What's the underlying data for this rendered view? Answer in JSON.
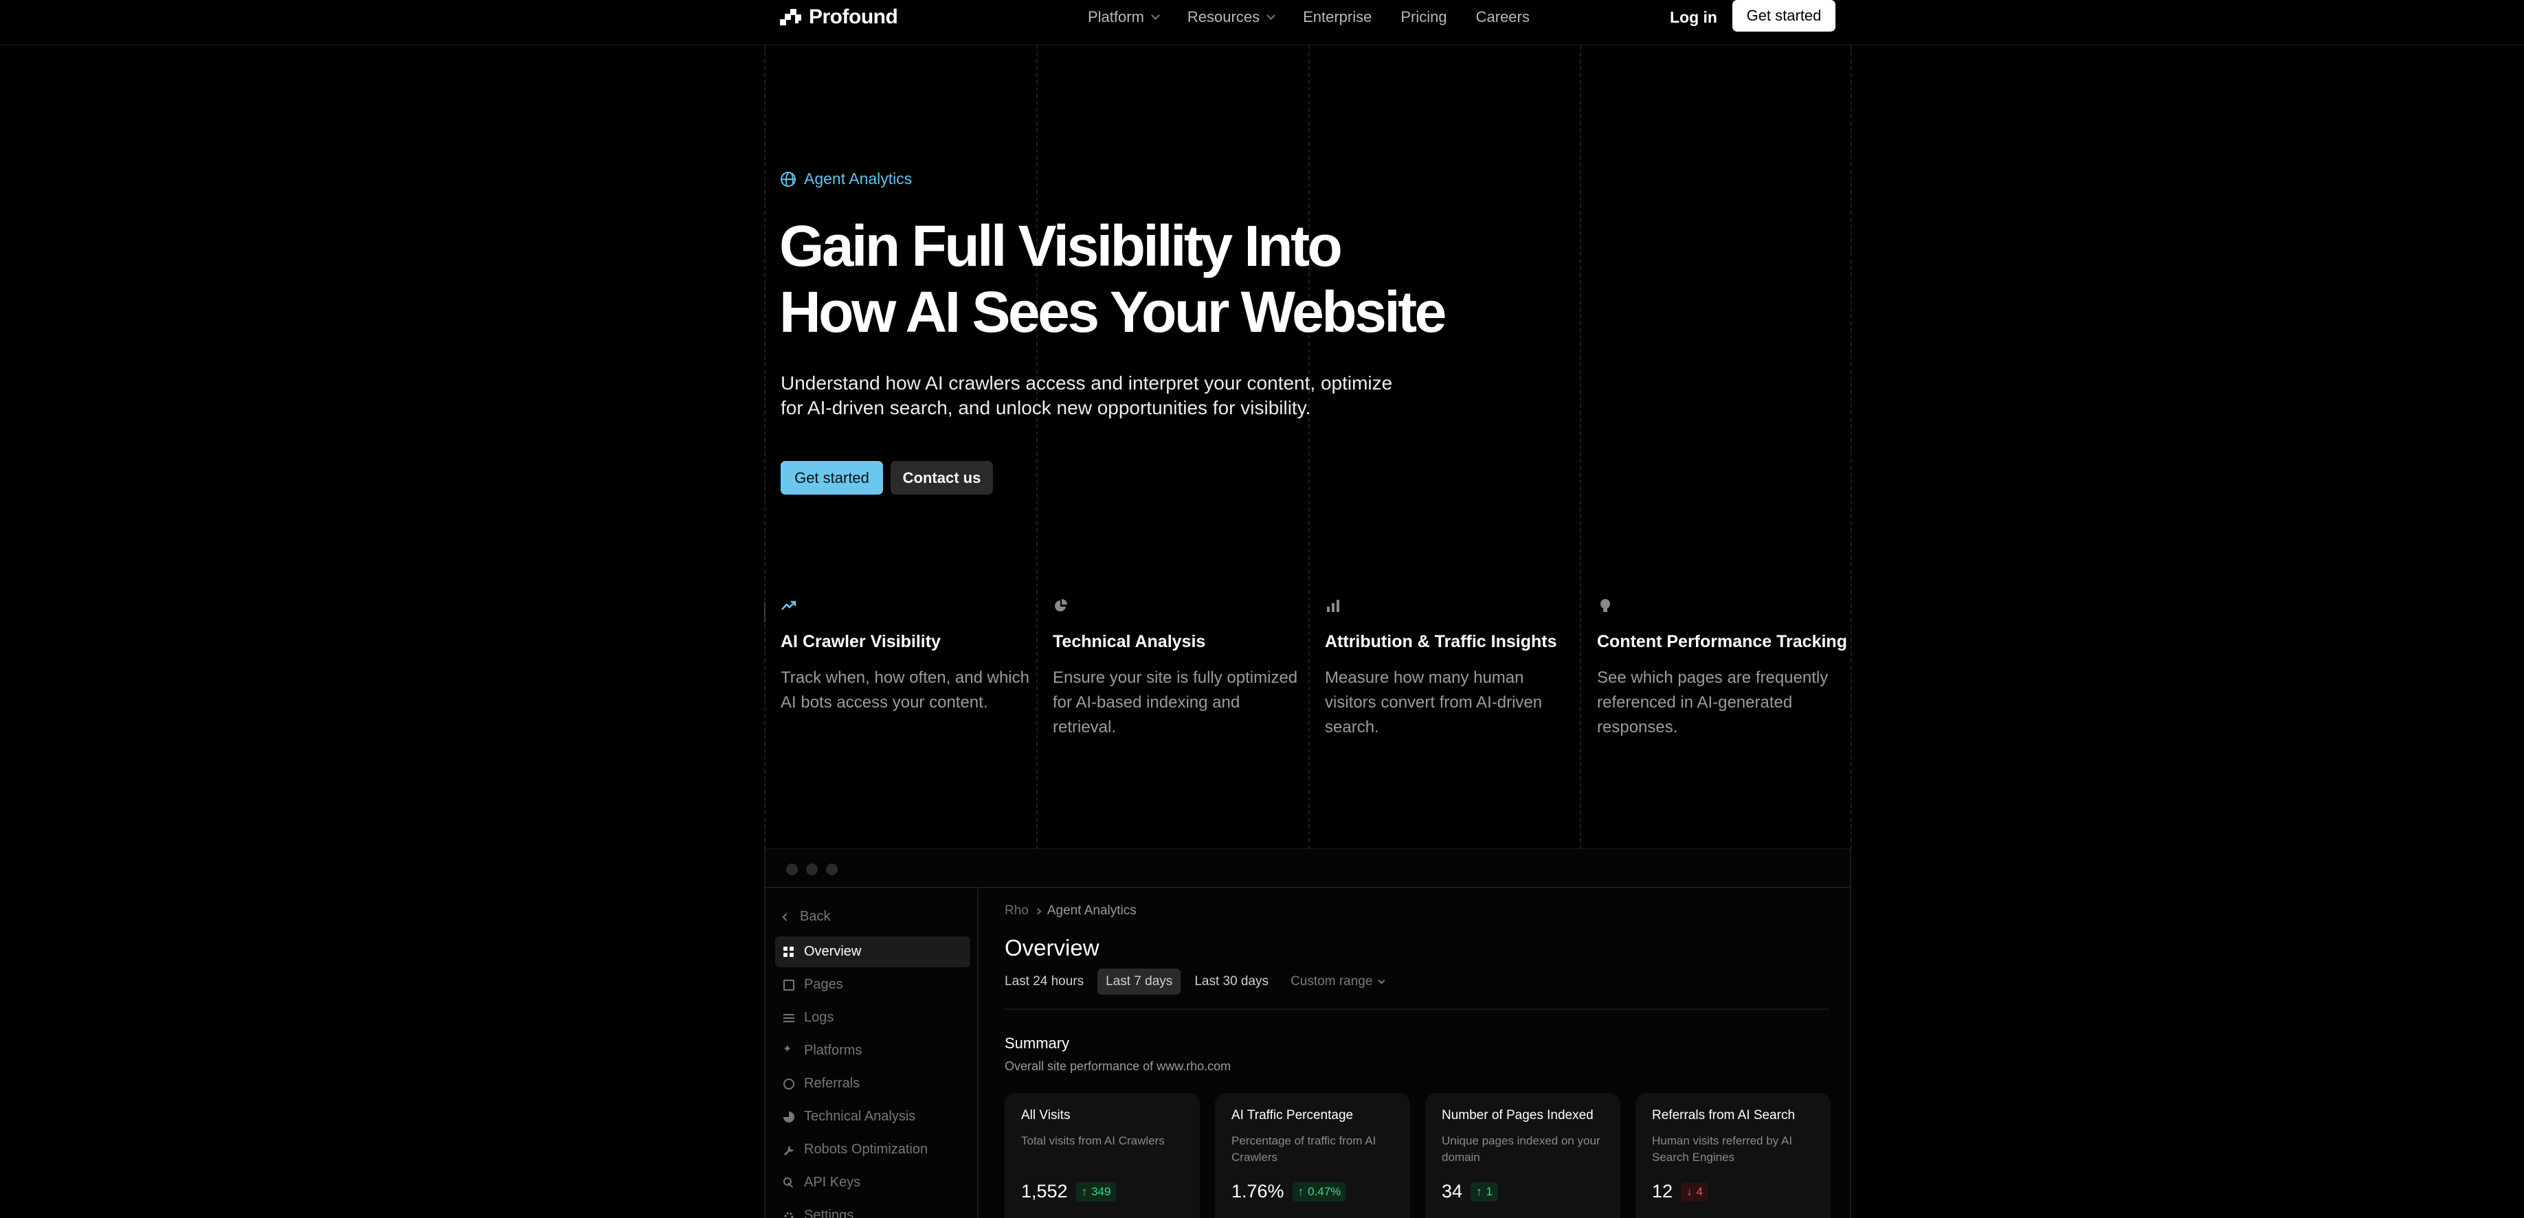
{
  "nav": {
    "brand": "Profound",
    "links": [
      {
        "label": "Platform",
        "has_dropdown": true
      },
      {
        "label": "Resources",
        "has_dropdown": true
      },
      {
        "label": "Enterprise",
        "has_dropdown": false
      },
      {
        "label": "Pricing",
        "has_dropdown": false
      },
      {
        "label": "Careers",
        "has_dropdown": false
      }
    ],
    "login": "Log in",
    "cta": "Get started"
  },
  "hero": {
    "eyebrow": "Agent Analytics",
    "title_line1": "Gain Full Visibility Into",
    "title_line2": "How AI Sees Your Website",
    "subtitle_line1": "Understand how AI crawlers access and interpret your content, optimize",
    "subtitle_line2": "for AI-driven search, and unlock new opportunities for visibility.",
    "primary_button": "Get started",
    "secondary_button": "Contact us"
  },
  "features": [
    {
      "icon": "trending-up-icon",
      "title": "AI Crawler Visibility",
      "description": "Track when, how often, and which AI bots access your content."
    },
    {
      "icon": "pie-chart-icon",
      "title": "Technical Analysis",
      "description": "Ensure your site is fully optimized for AI-based indexing and retrieval."
    },
    {
      "icon": "bar-chart-icon",
      "title": "Attribution & Traffic Insights",
      "description": "Measure how many human visitors convert from AI-driven search."
    },
    {
      "icon": "lightbulb-icon",
      "title": "Content Performance Tracking",
      "description": "See which pages are frequently referenced in AI-generated responses."
    }
  ],
  "app": {
    "back_label": "Back",
    "sidebar": [
      {
        "label": "Overview",
        "icon": "grid-icon",
        "active": true
      },
      {
        "label": "Pages",
        "icon": "page-icon",
        "active": false
      },
      {
        "label": "Logs",
        "icon": "list-icon",
        "active": false
      },
      {
        "label": "Platforms",
        "icon": "sparkle-icon",
        "active": false
      },
      {
        "label": "Referrals",
        "icon": "referral-icon",
        "active": false
      },
      {
        "label": "Technical Analysis",
        "icon": "pie-chart-icon",
        "active": false
      },
      {
        "label": "Robots Optimization",
        "icon": "wrench-icon",
        "active": false
      },
      {
        "label": "API Keys",
        "icon": "key-icon",
        "active": false
      },
      {
        "label": "Settings",
        "icon": "gear-icon",
        "active": false
      }
    ],
    "breadcrumb": [
      "Rho",
      "Agent Analytics"
    ],
    "page_title": "Overview",
    "ranges": [
      "Last 24 hours",
      "Last 7 days",
      "Last 30 days",
      "Custom range"
    ],
    "active_range": "Last 7 days",
    "summary_title": "Summary",
    "summary_subtitle": "Overall site performance of www.rho.com",
    "cards": [
      {
        "title": "All Visits",
        "description": "Total visits from AI Crawlers",
        "value": "1,552",
        "delta": "349",
        "direction": "up"
      },
      {
        "title": "AI Traffic Percentage",
        "description": "Percentage of traffic from AI Crawlers",
        "value": "1.76%",
        "delta": "0.47%",
        "direction": "up"
      },
      {
        "title": "Number of Pages Indexed",
        "description": "Unique pages indexed on your domain",
        "value": "34",
        "delta": "1",
        "direction": "up"
      },
      {
        "title": "Referrals from AI Search",
        "description": "Human visits referred by AI Search Engines",
        "value": "12",
        "delta": "4",
        "direction": "down"
      }
    ]
  },
  "colors": {
    "accent": "#5fc4ef",
    "primary_button": "#6cc7ee",
    "positive": "#3fd68a",
    "negative": "#f2555a"
  }
}
